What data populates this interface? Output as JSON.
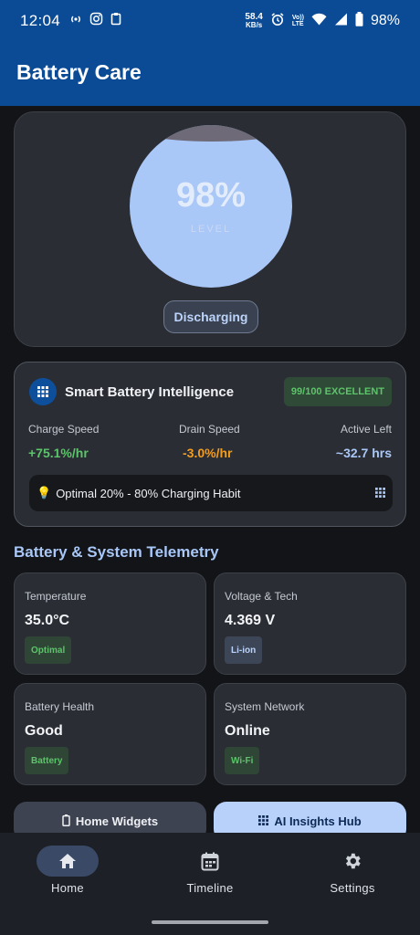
{
  "status_bar": {
    "time": "12:04",
    "net_speed_value": "58.4",
    "net_speed_unit": "KB/s",
    "volte_top": "Vo))",
    "volte_bottom": "LTE",
    "battery_percent": "98%"
  },
  "app": {
    "title": "Battery Care"
  },
  "battery": {
    "level_text": "98%",
    "level_value": 98,
    "level_caption": "LEVEL",
    "state": "Discharging"
  },
  "intelligence": {
    "title": "Smart Battery Intelligence",
    "score": "99/100 EXCELLENT",
    "charge_speed_label": "Charge Speed",
    "charge_speed_value": "+75.1%/hr",
    "drain_speed_label": "Drain Speed",
    "drain_speed_value": "-3.0%/hr",
    "active_left_label": "Active Left",
    "active_left_value": "~32.7 hrs",
    "habit_icon": "💡",
    "habit_text": "Optimal 20% - 80% Charging Habit"
  },
  "telemetry": {
    "section_title": "Battery & System Telemetry",
    "tiles": [
      {
        "label": "Temperature",
        "value": "35.0°C",
        "badge": "Optimal"
      },
      {
        "label": "Voltage & Tech",
        "value": "4.369 V",
        "badge": "Li-ion"
      },
      {
        "label": "Battery Health",
        "value": "Good",
        "badge": "Battery"
      },
      {
        "label": "System Network",
        "value": "Online",
        "badge": "Wi-Fi"
      }
    ]
  },
  "actions": {
    "widgets_label": "Home Widgets",
    "insights_label": "AI Insights Hub"
  },
  "nav": {
    "home": "Home",
    "timeline": "Timeline",
    "settings": "Settings"
  },
  "colors": {
    "app_bar": "#0b4a94",
    "accent": "#a9c7f7",
    "positive": "#5cc46a",
    "warning": "#f39c1f"
  },
  "icons": {
    "status": [
      "hotspot-icon",
      "instagram-icon",
      "clipboard-icon",
      "alarm-icon",
      "wifi-icon",
      "signal-icon",
      "battery-icon"
    ],
    "intel_logo": "grid-icon",
    "widgets": "battery-outline-icon",
    "insights": "grid-icon",
    "nav": [
      "home-icon",
      "calendar-icon",
      "gear-icon"
    ]
  }
}
